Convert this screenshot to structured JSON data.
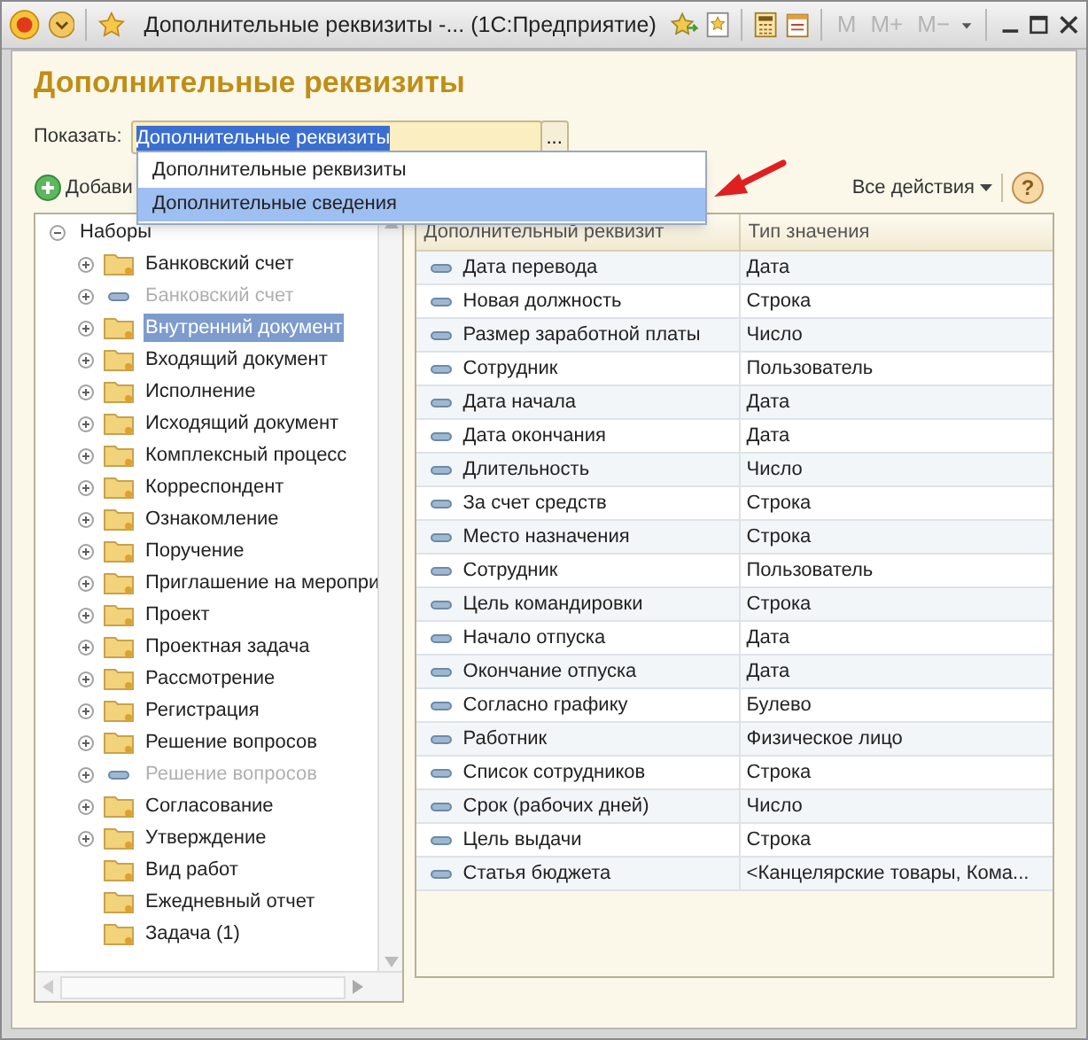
{
  "window": {
    "title": "Дополнительные реквизиты -...  (1С:Предприятие)",
    "memory_buttons": [
      {
        "label": "M",
        "disabled": true
      },
      {
        "label": "M+",
        "disabled": true
      },
      {
        "label": "M−",
        "disabled": true
      }
    ]
  },
  "heading": "Дополнительные реквизиты",
  "show_field": {
    "label": "Показать:",
    "value": "Дополнительные реквизиты",
    "button": "..."
  },
  "dropdown": {
    "items": [
      {
        "label": "Дополнительные реквизиты",
        "selected": false
      },
      {
        "label": "Дополнительные сведения",
        "selected": true
      }
    ]
  },
  "toolbar": {
    "add_button": "Добави",
    "all_actions": "Все действия",
    "help": "?"
  },
  "tree": {
    "root": {
      "label": "Наборы",
      "expanded": true,
      "children": [
        {
          "label": "Банковский счет",
          "kind": "folder",
          "expandable": true,
          "disabled": false,
          "selected": false
        },
        {
          "label": "Банковский счет",
          "kind": "property",
          "expandable": true,
          "disabled": true,
          "selected": false
        },
        {
          "label": "Внутренний документ",
          "kind": "folder",
          "expandable": true,
          "disabled": false,
          "selected": true
        },
        {
          "label": "Входящий документ",
          "kind": "folder",
          "expandable": true,
          "disabled": false,
          "selected": false
        },
        {
          "label": "Исполнение",
          "kind": "folder",
          "expandable": true,
          "disabled": false,
          "selected": false
        },
        {
          "label": "Исходящий документ",
          "kind": "folder",
          "expandable": true,
          "disabled": false,
          "selected": false
        },
        {
          "label": "Комплексный процесс",
          "kind": "folder",
          "expandable": true,
          "disabled": false,
          "selected": false
        },
        {
          "label": "Корреспондент",
          "kind": "folder",
          "expandable": true,
          "disabled": false,
          "selected": false
        },
        {
          "label": "Ознакомление",
          "kind": "folder",
          "expandable": true,
          "disabled": false,
          "selected": false
        },
        {
          "label": "Поручение",
          "kind": "folder",
          "expandable": true,
          "disabled": false,
          "selected": false
        },
        {
          "label": "Приглашение на меропри",
          "kind": "folder",
          "expandable": true,
          "disabled": false,
          "selected": false
        },
        {
          "label": "Проект",
          "kind": "folder",
          "expandable": true,
          "disabled": false,
          "selected": false
        },
        {
          "label": "Проектная задача",
          "kind": "folder",
          "expandable": true,
          "disabled": false,
          "selected": false
        },
        {
          "label": "Рассмотрение",
          "kind": "folder",
          "expandable": true,
          "disabled": false,
          "selected": false
        },
        {
          "label": "Регистрация",
          "kind": "folder",
          "expandable": true,
          "disabled": false,
          "selected": false
        },
        {
          "label": "Решение вопросов",
          "kind": "folder",
          "expandable": true,
          "disabled": false,
          "selected": false
        },
        {
          "label": "Решение вопросов",
          "kind": "property",
          "expandable": true,
          "disabled": true,
          "selected": false
        },
        {
          "label": "Согласование",
          "kind": "folder",
          "expandable": true,
          "disabled": false,
          "selected": false
        },
        {
          "label": "Утверждение",
          "kind": "folder",
          "expandable": true,
          "disabled": false,
          "selected": false
        },
        {
          "label": "Вид работ",
          "kind": "folder",
          "expandable": false,
          "disabled": false,
          "selected": false
        },
        {
          "label": "Ежедневный отчет",
          "kind": "folder",
          "expandable": false,
          "disabled": false,
          "selected": false
        },
        {
          "label": "Задача (1)",
          "kind": "folder",
          "expandable": false,
          "disabled": false,
          "selected": false
        }
      ]
    }
  },
  "table": {
    "columns": [
      "Дополнительный реквизит",
      "Тип значения"
    ],
    "rows": [
      [
        "Дата перевода",
        "Дата"
      ],
      [
        "Новая должность",
        "Строка"
      ],
      [
        "Размер заработной платы",
        "Число"
      ],
      [
        "Сотрудник",
        "Пользователь"
      ],
      [
        "Дата начала",
        "Дата"
      ],
      [
        "Дата окончания",
        "Дата"
      ],
      [
        "Длительность",
        "Число"
      ],
      [
        "За счет средств",
        "Строка"
      ],
      [
        "Место назначения",
        "Строка"
      ],
      [
        "Сотрудник",
        "Пользователь"
      ],
      [
        "Цель командировки",
        "Строка"
      ],
      [
        "Начало отпуска",
        "Дата"
      ],
      [
        "Окончание отпуска",
        "Дата"
      ],
      [
        "Согласно графику",
        "Булево"
      ],
      [
        "Работник",
        "Физическое лицо"
      ],
      [
        "Список сотрудников",
        "Строка"
      ],
      [
        "Срок (рабочих дней)",
        "Число"
      ],
      [
        "Цель выдачи",
        "Строка"
      ],
      [
        "Статья бюджета",
        "<Канцелярские товары, Кома..."
      ]
    ]
  }
}
